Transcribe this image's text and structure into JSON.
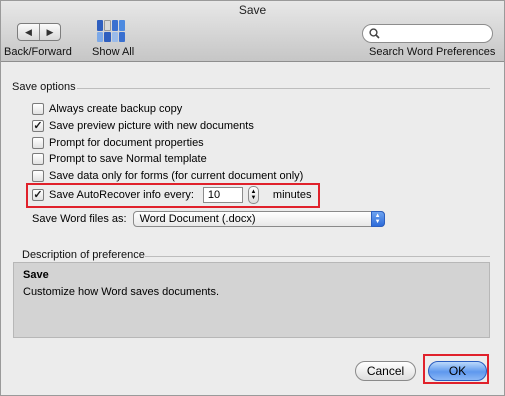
{
  "window": {
    "title": "Save"
  },
  "toolbar": {
    "back_icon": "◀",
    "forward_icon": "▶",
    "nav_label": "Back/Forward",
    "show_all_label": "Show All",
    "search_label": "Search Word Preferences",
    "search_value": ""
  },
  "save_options": {
    "title": "Save options",
    "items": [
      {
        "label": "Always create backup copy",
        "checked": false
      },
      {
        "label": "Save preview picture with new documents",
        "checked": true
      },
      {
        "label": "Prompt for document properties",
        "checked": false
      },
      {
        "label": "Prompt to save Normal template",
        "checked": false
      },
      {
        "label": "Save data only for forms (for current document only)",
        "checked": false
      },
      {
        "label": "Save AutoRecover info every:",
        "checked": true
      }
    ],
    "autorecover_minutes": "10",
    "minutes_label": "minutes",
    "save_as_label": "Save Word files as:",
    "save_as_value": "Word Document (.docx)"
  },
  "description": {
    "title": "Description of preference",
    "heading": "Save",
    "text": "Customize how Word saves documents."
  },
  "buttons": {
    "cancel": "Cancel",
    "ok": "OK"
  },
  "colors": {
    "highlight": "#e0212b",
    "accent": "#5e98ee"
  }
}
